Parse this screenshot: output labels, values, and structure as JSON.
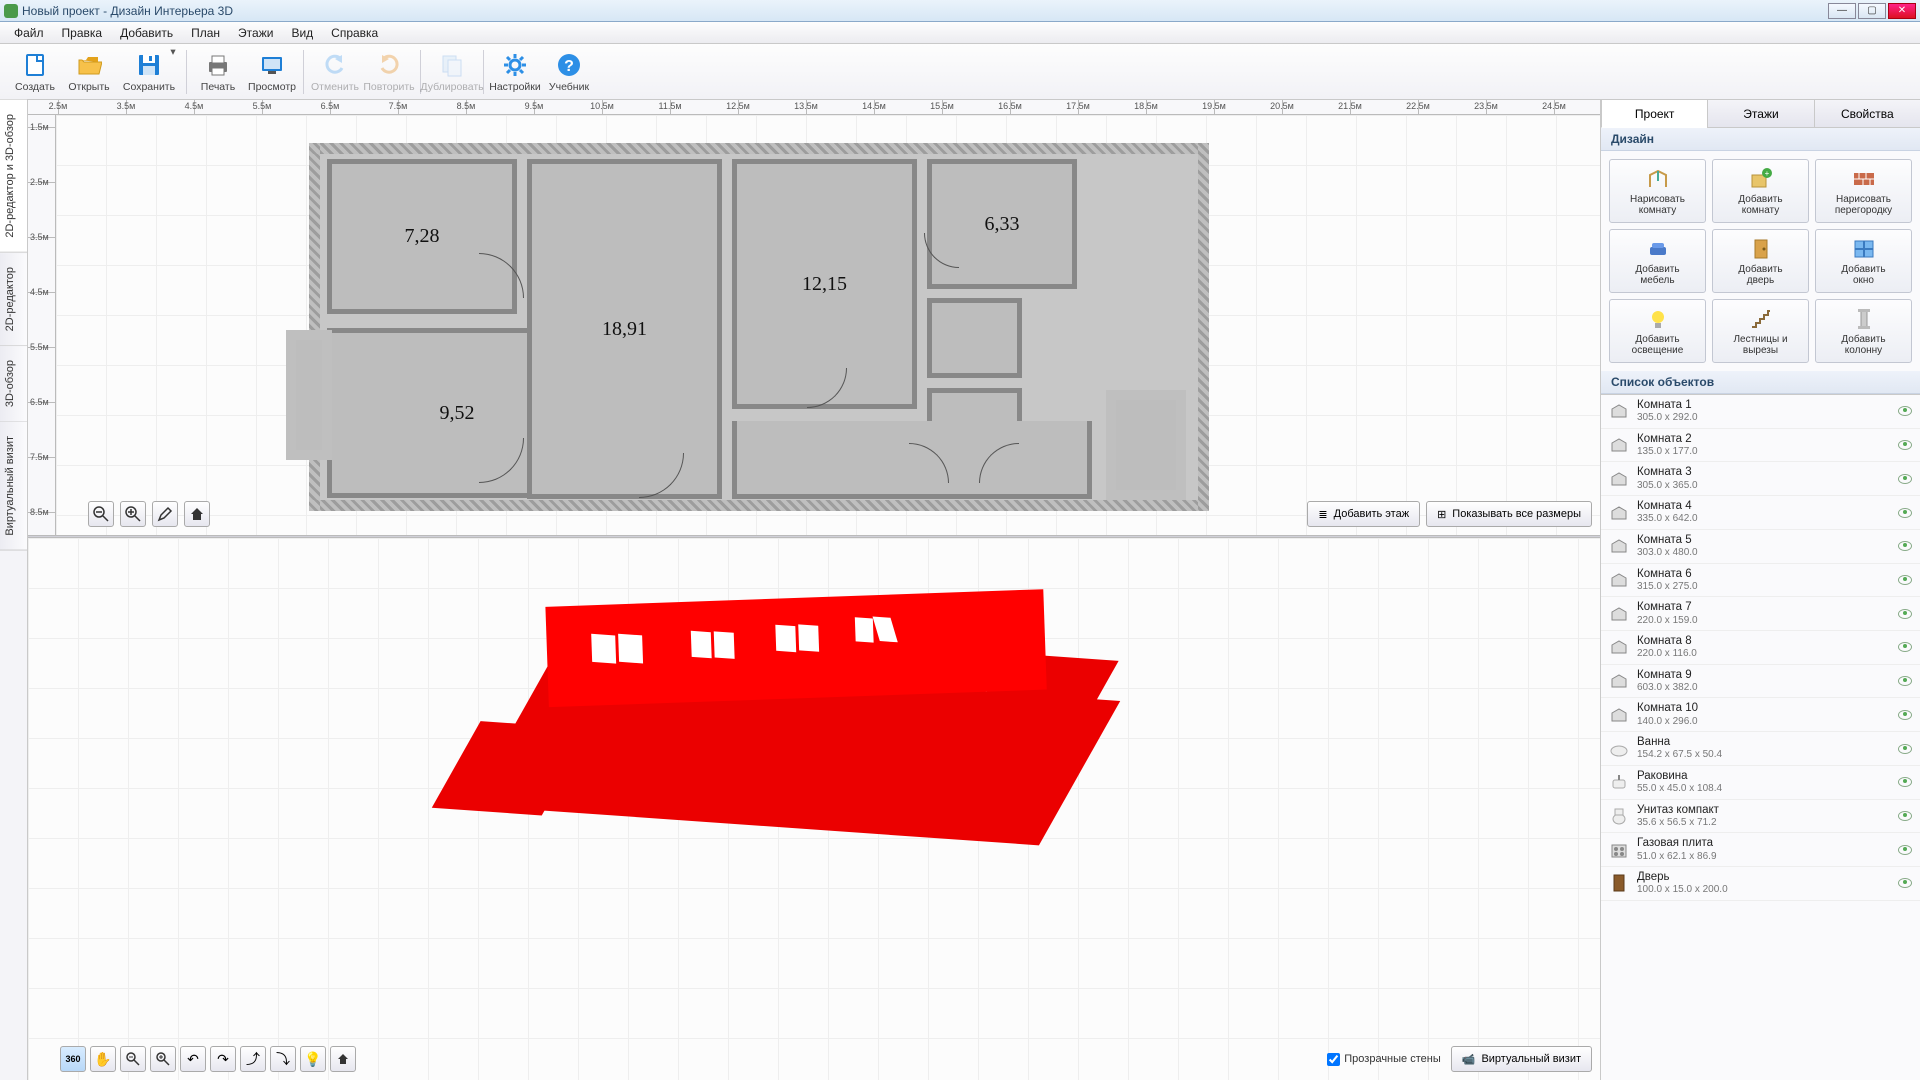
{
  "window": {
    "title": "Новый проект - Дизайн Интерьера 3D"
  },
  "menu": [
    "Файл",
    "Правка",
    "Добавить",
    "План",
    "Этажи",
    "Вид",
    "Справка"
  ],
  "toolbar": [
    {
      "id": "new",
      "label": "Создать",
      "color": "#1e7fd6"
    },
    {
      "id": "open",
      "label": "Открыть",
      "color": "#e3a21b"
    },
    {
      "id": "save",
      "label": "Сохранить",
      "color": "#1e7fd6",
      "drop": true
    },
    {
      "sep": true
    },
    {
      "id": "print",
      "label": "Печать",
      "color": "#555"
    },
    {
      "id": "preview",
      "label": "Просмотр",
      "color": "#1e7fd6"
    },
    {
      "sep": true
    },
    {
      "id": "undo",
      "label": "Отменить",
      "color": "#6ab0f0",
      "disabled": true
    },
    {
      "id": "redo",
      "label": "Повторить",
      "color": "#e89a3a",
      "disabled": true
    },
    {
      "sep": true
    },
    {
      "id": "dup",
      "label": "Дублировать",
      "color": "#8ab6e8",
      "disabled": true
    },
    {
      "sep": true
    },
    {
      "id": "settings",
      "label": "Настройки",
      "color": "#2d8fe6"
    },
    {
      "id": "tutorial",
      "label": "Учебник",
      "color": "#2d8fe6"
    }
  ],
  "vtabs": [
    {
      "id": "combo",
      "label": "2D-редактор и 3D-обзор",
      "active": true
    },
    {
      "id": "2d",
      "label": "2D-редактор"
    },
    {
      "id": "3d",
      "label": "3D-обзор"
    },
    {
      "id": "vr",
      "label": "Виртуальный визит"
    }
  ],
  "ruler_h": [
    "2.5м",
    "3.5м",
    "4.5м",
    "5.5м",
    "6.5м",
    "7.5м",
    "8.5м",
    "9.5м",
    "10.5м",
    "11.5м",
    "12.5м",
    "13.5м",
    "14.5м",
    "15.5м",
    "16.5м",
    "17.5м",
    "18.5м",
    "19.5м",
    "20.5м",
    "21.5м",
    "22.5м",
    "23.5м",
    "24.5м"
  ],
  "ruler_v": [
    "1.5м",
    "2.5м",
    "3.5м",
    "4.5м",
    "5.5м",
    "6.5м",
    "7.5м",
    "8.5м"
  ],
  "rooms": {
    "r728": "7,28",
    "r1891": "18,91",
    "r1215": "12,15",
    "r633": "6,33",
    "r952": "9,52"
  },
  "plan_buttons": {
    "add_floor": "Добавить этаж",
    "show_dims": "Показывать все размеры"
  },
  "view3d": {
    "transparent": "Прозрачные стены",
    "virtual": "Виртуальный визит"
  },
  "rtabs": [
    "Проект",
    "Этажи",
    "Свойства"
  ],
  "sections": {
    "design": "Дизайн",
    "objects": "Список объектов"
  },
  "design_buttons": [
    {
      "id": "draw-room",
      "l1": "Нарисовать",
      "l2": "комнату"
    },
    {
      "id": "add-room",
      "l1": "Добавить",
      "l2": "комнату"
    },
    {
      "id": "draw-partition",
      "l1": "Нарисовать",
      "l2": "перегородку"
    },
    {
      "id": "add-furn",
      "l1": "Добавить",
      "l2": "мебель"
    },
    {
      "id": "add-door",
      "l1": "Добавить",
      "l2": "дверь"
    },
    {
      "id": "add-window",
      "l1": "Добавить",
      "l2": "окно"
    },
    {
      "id": "add-light",
      "l1": "Добавить",
      "l2": "освещение"
    },
    {
      "id": "stairs",
      "l1": "Лестницы и",
      "l2": "вырезы"
    },
    {
      "id": "add-column",
      "l1": "Добавить",
      "l2": "колонну"
    }
  ],
  "objects": [
    {
      "name": "Комната 1",
      "dim": "305.0 x 292.0",
      "type": "room"
    },
    {
      "name": "Комната 2",
      "dim": "135.0 x 177.0",
      "type": "room"
    },
    {
      "name": "Комната 3",
      "dim": "305.0 x 365.0",
      "type": "room"
    },
    {
      "name": "Комната 4",
      "dim": "335.0 x 642.0",
      "type": "room"
    },
    {
      "name": "Комната 5",
      "dim": "303.0 x 480.0",
      "type": "room"
    },
    {
      "name": "Комната 6",
      "dim": "315.0 x 275.0",
      "type": "room"
    },
    {
      "name": "Комната 7",
      "dim": "220.0 x 159.0",
      "type": "room"
    },
    {
      "name": "Комната 8",
      "dim": "220.0 x 116.0",
      "type": "room"
    },
    {
      "name": "Комната 9",
      "dim": "603.0 x 382.0",
      "type": "room"
    },
    {
      "name": "Комната 10",
      "dim": "140.0 x 296.0",
      "type": "room"
    },
    {
      "name": "Ванна",
      "dim": "154.2 x 67.5 x 50.4",
      "type": "bath"
    },
    {
      "name": "Раковина",
      "dim": "55.0 x 45.0 x 108.4",
      "type": "sink"
    },
    {
      "name": "Унитаз компакт",
      "dim": "35.6 x 56.5 x 71.2",
      "type": "toilet"
    },
    {
      "name": "Газовая плита",
      "dim": "51.0 x 62.1 x 86.9",
      "type": "stove"
    },
    {
      "name": "Дверь",
      "dim": "100.0 x 15.0 x 200.0",
      "type": "door"
    }
  ]
}
